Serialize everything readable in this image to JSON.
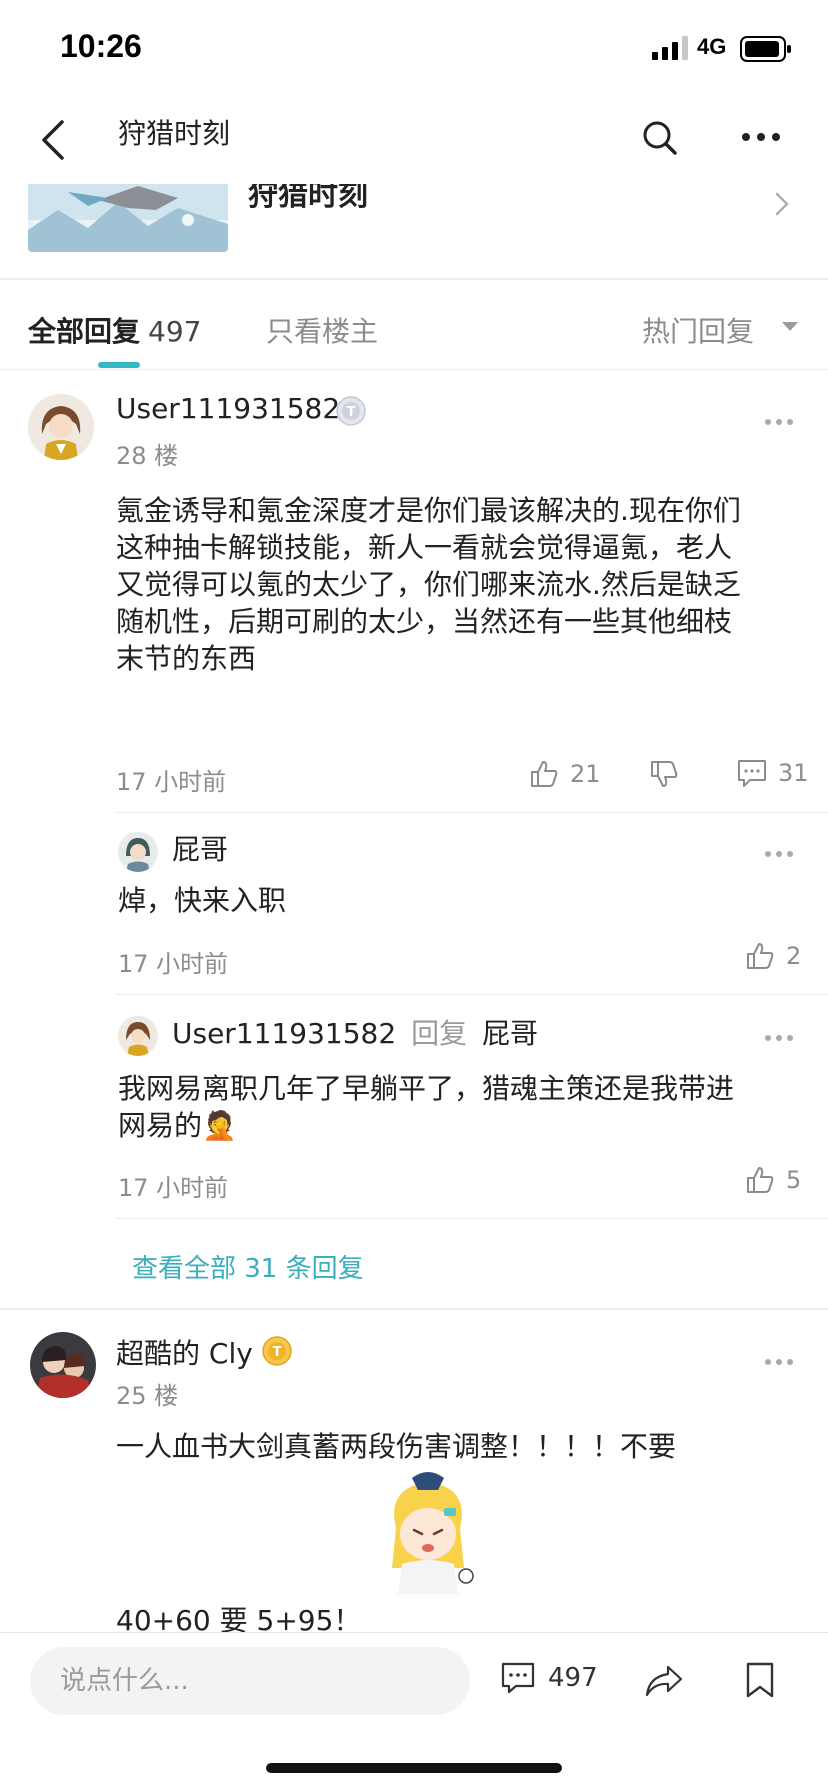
{
  "status": {
    "time": "10:26",
    "network": "4G"
  },
  "nav": {
    "title": "狩猎时刻"
  },
  "topic": {
    "title": "狩猎时刻"
  },
  "tabs": {
    "all_label": "全部回复",
    "all_count": "497",
    "op_only": "只看楼主",
    "sort": "热门回复"
  },
  "comments": [
    {
      "username": "User111931582",
      "floor": "28 楼",
      "lines": [
        "氪金诱导和氪金深度才是你们最该解决的.现在你们",
        "这种抽卡解锁技能，新人一看就会觉得逼氪，老人",
        "又觉得可以氪的太少了，你们哪来流水.然后是缺乏",
        "随机性，后期可刷的太少，当然还有一些其他细枝",
        "末节的东西"
      ],
      "time": "17 小时前",
      "likes": "21",
      "replies_count": "31",
      "replies": [
        {
          "username": "屁哥",
          "text": "焯，快来入职",
          "time": "17 小时前",
          "likes": "2"
        },
        {
          "username": "User111931582",
          "reply_word": "回复",
          "reply_to": "屁哥",
          "lines": [
            "我网易离职几年了早躺平了，猎魂主策还是我带进",
            "网易的🤦"
          ],
          "time": "17 小时前",
          "likes": "5"
        }
      ],
      "view_all": "查看全部 31 条回复"
    },
    {
      "username": "超酷的 Cly",
      "floor": "25 楼",
      "line1": "一人血书大剑真蓄两段伤害调整！！！！不要",
      "line2": "40+60 要 5+95！"
    }
  ],
  "bottom": {
    "placeholder": "说点什么...",
    "comment_count": "497"
  },
  "colors": {
    "accent": "#36b8c4",
    "link": "#3aaebc"
  }
}
